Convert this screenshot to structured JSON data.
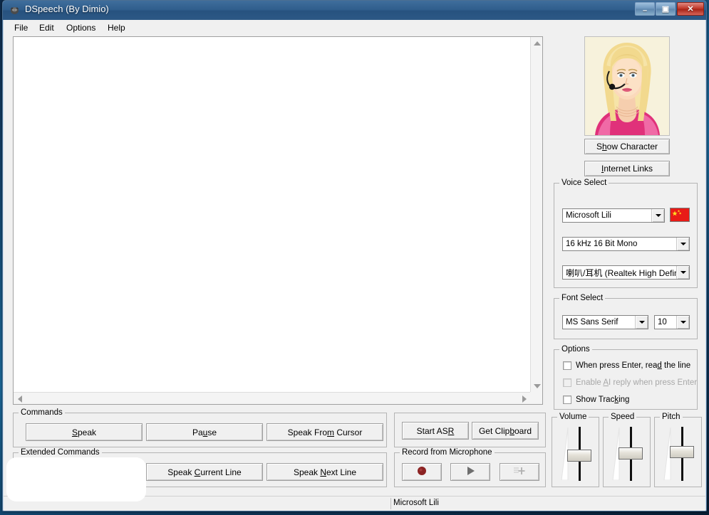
{
  "window": {
    "title": "DSpeech (By Dimio)",
    "icon": "app-icon",
    "controls": {
      "minimize": "–",
      "maximize": "▣",
      "close": "✕"
    }
  },
  "menubar": {
    "items": [
      {
        "label": "File"
      },
      {
        "label": "Edit"
      },
      {
        "label": "Options"
      },
      {
        "label": "Help"
      }
    ]
  },
  "editor": {
    "value": "",
    "placeholder": ""
  },
  "character": {
    "image_alt": "blonde-woman-with-headset-avatar",
    "show_character_button": "Show Character",
    "internet_links_button": "Internet Links"
  },
  "voice_select": {
    "caption": "Voice Select",
    "voice": "Microsoft Lili",
    "flag": "china-flag-icon",
    "format": "16 kHz 16 Bit Mono",
    "device": "喇叭/耳机 (Realtek High Definit"
  },
  "font_select": {
    "caption": "Font Select",
    "font": "MS Sans Serif",
    "size": "10"
  },
  "options": {
    "caption": "Options",
    "items": [
      {
        "label_pre": "When press Enter, rea",
        "accel": "d",
        "label_post": " the line",
        "checked": false,
        "disabled": false
      },
      {
        "label_pre": "Enable ",
        "accel": "A",
        "label_post": "I reply when press Enter",
        "checked": false,
        "disabled": true
      },
      {
        "label_pre": "Show Trac",
        "accel": "k",
        "label_post": "ing",
        "checked": false,
        "disabled": false
      }
    ]
  },
  "commands": {
    "caption": "Commands",
    "buttons": [
      {
        "pre": "",
        "accel": "S",
        "post": "peak"
      },
      {
        "pre": "Pa",
        "accel": "u",
        "post": "se"
      },
      {
        "pre": "Speak Fro",
        "accel": "m",
        "post": " Cursor"
      }
    ]
  },
  "extended_commands": {
    "caption": "Extended Commands",
    "buttons": [
      {
        "pre": "Speak ",
        "accel": "C",
        "post": "urrent Line"
      },
      {
        "pre": "Speak ",
        "accel": "N",
        "post": "ext Line"
      }
    ]
  },
  "asr": {
    "start_button": {
      "pre": "Start AS",
      "accel": "R",
      "post": ""
    },
    "clipboard_button": {
      "pre": "Get Clip",
      "accel": "b",
      "post": "oard"
    }
  },
  "record": {
    "caption": "Record from Microphone",
    "buttons": [
      {
        "name": "record-button",
        "icon": "record-circle-icon",
        "disabled": false
      },
      {
        "name": "play-button",
        "icon": "play-triangle-icon",
        "disabled": false
      },
      {
        "name": "add-button",
        "icon": "plus-icon",
        "disabled": true
      }
    ]
  },
  "sliders": [
    {
      "caption": "Volume",
      "value": 45
    },
    {
      "caption": "Speed",
      "value": 50
    },
    {
      "caption": "Pitch",
      "value": 52
    }
  ],
  "statusbar": {
    "text": "Microsoft Lili"
  },
  "colors": {
    "titlebar": "#2f5d8c",
    "close_button": "#c23a2c",
    "face": "#f0f0f0",
    "flag_red": "#e81b17",
    "desktop": "#14466f"
  }
}
